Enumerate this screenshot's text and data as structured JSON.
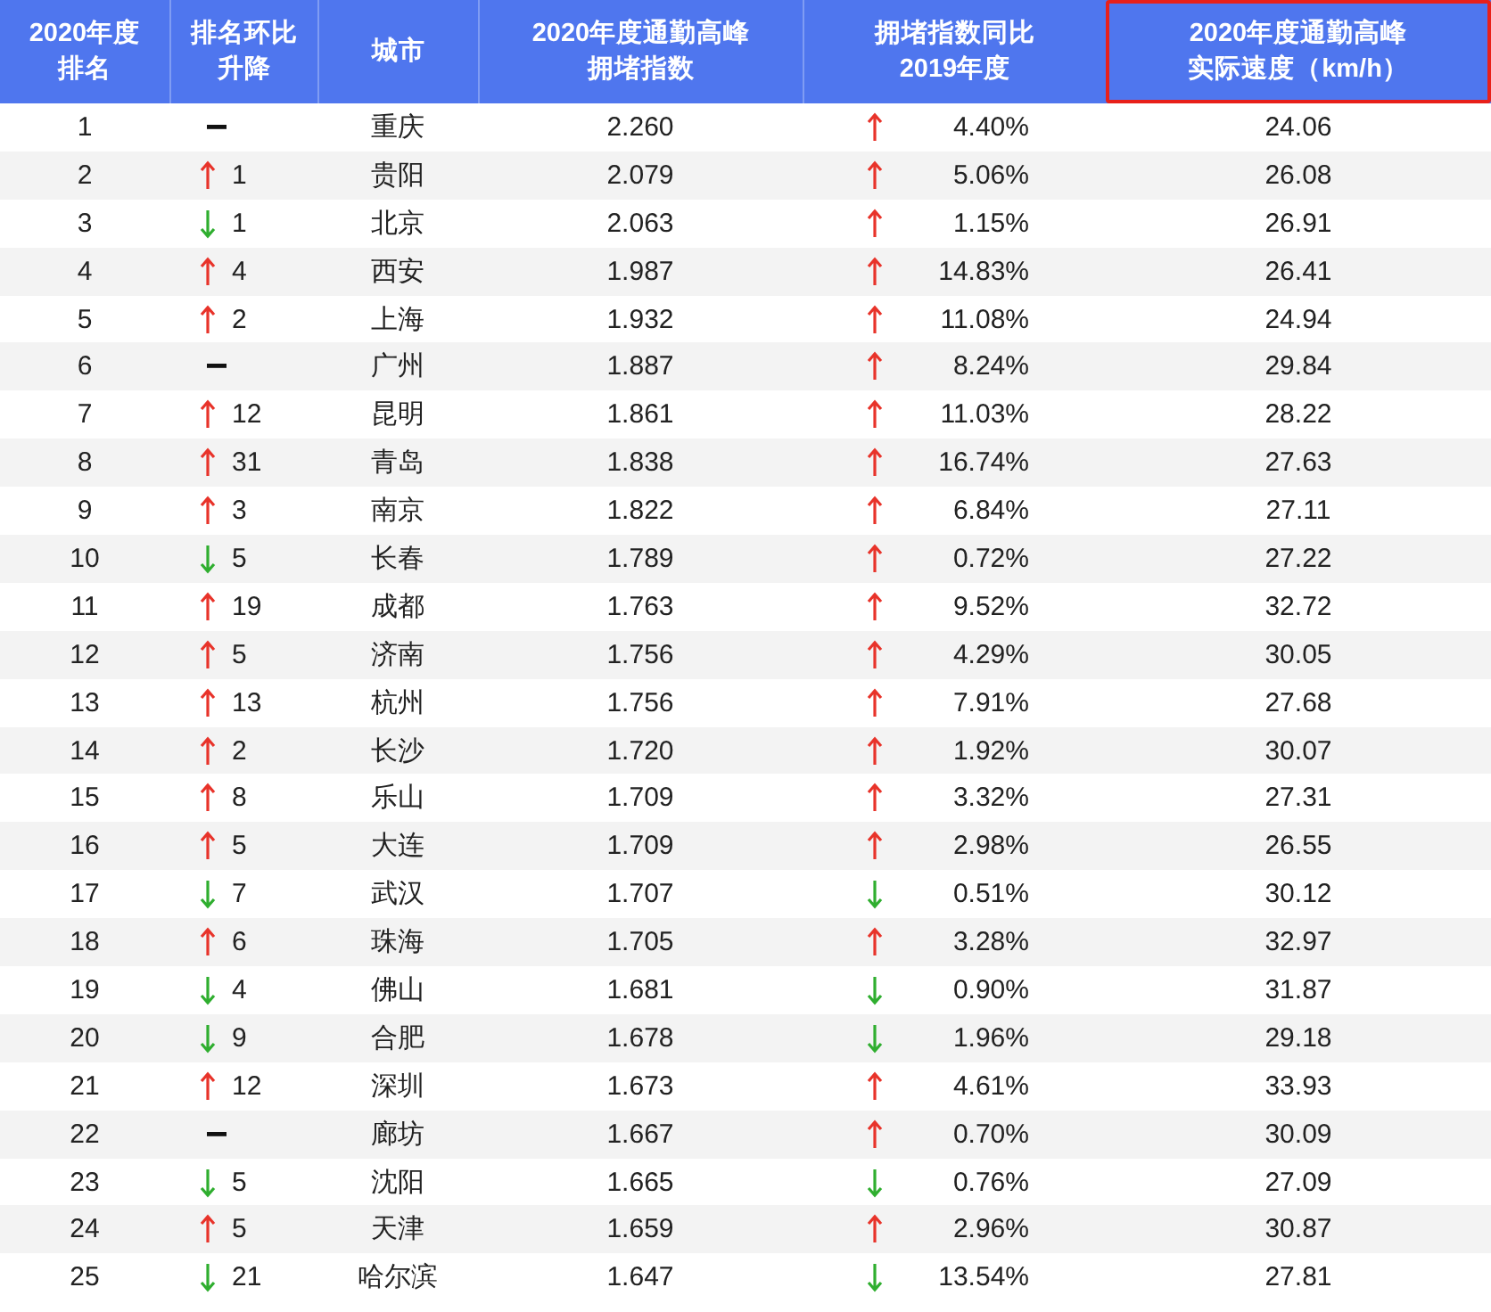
{
  "table": {
    "columns": [
      {
        "lines": [
          "2020年度",
          "排名"
        ],
        "highlighted": false
      },
      {
        "lines": [
          "排名环比",
          "升降"
        ],
        "highlighted": false
      },
      {
        "lines": [
          "城市"
        ],
        "highlighted": false
      },
      {
        "lines": [
          "2020年度通勤高峰",
          "拥堵指数"
        ],
        "highlighted": false
      },
      {
        "lines": [
          "拥堵指数同比",
          "2019年度"
        ],
        "highlighted": false
      },
      {
        "lines": [
          "2020年度通勤高峰",
          "实际速度（km/h）"
        ],
        "highlighted": true
      }
    ],
    "rows": [
      {
        "rank": "1",
        "rank_up": false,
        "rank_down": false,
        "city": "重庆",
        "index": "2.260",
        "yoy_up": true,
        "yoy_value": "4.40%",
        "speed": "24.06"
      },
      {
        "rank": "2",
        "rank_up": true,
        "rank_down": false,
        "rank_delta": "1",
        "city": "贵阳",
        "index": "2.079",
        "yoy_up": true,
        "yoy_value": "5.06%",
        "speed": "26.08"
      },
      {
        "rank": "3",
        "rank_up": false,
        "rank_down": true,
        "rank_delta": "1",
        "city": "北京",
        "index": "2.063",
        "yoy_up": true,
        "yoy_value": "1.15%",
        "speed": "26.91"
      },
      {
        "rank": "4",
        "rank_up": true,
        "rank_down": false,
        "rank_delta": "4",
        "city": "西安",
        "index": "1.987",
        "yoy_up": true,
        "yoy_value": "14.83%",
        "speed": "26.41"
      },
      {
        "rank": "5",
        "rank_up": true,
        "rank_down": false,
        "rank_delta": "2",
        "city": "上海",
        "index": "1.932",
        "yoy_up": true,
        "yoy_value": "11.08%",
        "speed": "24.94"
      },
      {
        "rank": "6",
        "rank_up": false,
        "rank_down": false,
        "city": "广州",
        "index": "1.887",
        "yoy_up": true,
        "yoy_value": "8.24%",
        "speed": "29.84"
      },
      {
        "rank": "7",
        "rank_up": true,
        "rank_down": false,
        "rank_delta": "12",
        "city": "昆明",
        "index": "1.861",
        "yoy_up": true,
        "yoy_value": "11.03%",
        "speed": "28.22"
      },
      {
        "rank": "8",
        "rank_up": true,
        "rank_down": false,
        "rank_delta": "31",
        "city": "青岛",
        "index": "1.838",
        "yoy_up": true,
        "yoy_value": "16.74%",
        "speed": "27.63"
      },
      {
        "rank": "9",
        "rank_up": true,
        "rank_down": false,
        "rank_delta": "3",
        "city": "南京",
        "index": "1.822",
        "yoy_up": true,
        "yoy_value": "6.84%",
        "speed": "27.11"
      },
      {
        "rank": "10",
        "rank_up": false,
        "rank_down": true,
        "rank_delta": "5",
        "city": "长春",
        "index": "1.789",
        "yoy_up": true,
        "yoy_value": "0.72%",
        "speed": "27.22"
      },
      {
        "rank": "11",
        "rank_up": true,
        "rank_down": false,
        "rank_delta": "19",
        "city": "成都",
        "index": "1.763",
        "yoy_up": true,
        "yoy_value": "9.52%",
        "speed": "32.72"
      },
      {
        "rank": "12",
        "rank_up": true,
        "rank_down": false,
        "rank_delta": "5",
        "city": "济南",
        "index": "1.756",
        "yoy_up": true,
        "yoy_value": "4.29%",
        "speed": "30.05"
      },
      {
        "rank": "13",
        "rank_up": true,
        "rank_down": false,
        "rank_delta": "13",
        "city": "杭州",
        "index": "1.756",
        "yoy_up": true,
        "yoy_value": "7.91%",
        "speed": "27.68"
      },
      {
        "rank": "14",
        "rank_up": true,
        "rank_down": false,
        "rank_delta": "2",
        "city": "长沙",
        "index": "1.720",
        "yoy_up": true,
        "yoy_value": "1.92%",
        "speed": "30.07"
      },
      {
        "rank": "15",
        "rank_up": true,
        "rank_down": false,
        "rank_delta": "8",
        "city": "乐山",
        "index": "1.709",
        "yoy_up": true,
        "yoy_value": "3.32%",
        "speed": "27.31"
      },
      {
        "rank": "16",
        "rank_up": true,
        "rank_down": false,
        "rank_delta": "5",
        "city": "大连",
        "index": "1.709",
        "yoy_up": true,
        "yoy_value": "2.98%",
        "speed": "26.55"
      },
      {
        "rank": "17",
        "rank_up": false,
        "rank_down": true,
        "rank_delta": "7",
        "city": "武汉",
        "index": "1.707",
        "yoy_up": false,
        "yoy_value": "0.51%",
        "speed": "30.12"
      },
      {
        "rank": "18",
        "rank_up": true,
        "rank_down": false,
        "rank_delta": "6",
        "city": "珠海",
        "index": "1.705",
        "yoy_up": true,
        "yoy_value": "3.28%",
        "speed": "32.97"
      },
      {
        "rank": "19",
        "rank_up": false,
        "rank_down": true,
        "rank_delta": "4",
        "city": "佛山",
        "index": "1.681",
        "yoy_up": false,
        "yoy_value": "0.90%",
        "speed": "31.87"
      },
      {
        "rank": "20",
        "rank_up": false,
        "rank_down": true,
        "rank_delta": "9",
        "city": "合肥",
        "index": "1.678",
        "yoy_up": false,
        "yoy_value": "1.96%",
        "speed": "29.18"
      },
      {
        "rank": "21",
        "rank_up": true,
        "rank_down": false,
        "rank_delta": "12",
        "city": "深圳",
        "index": "1.673",
        "yoy_up": true,
        "yoy_value": "4.61%",
        "speed": "33.93"
      },
      {
        "rank": "22",
        "rank_up": false,
        "rank_down": false,
        "city": "廊坊",
        "index": "1.667",
        "yoy_up": true,
        "yoy_value": "0.70%",
        "speed": "30.09"
      },
      {
        "rank": "23",
        "rank_up": false,
        "rank_down": true,
        "rank_delta": "5",
        "city": "沈阳",
        "index": "1.665",
        "yoy_up": false,
        "yoy_value": "0.76%",
        "speed": "27.09"
      },
      {
        "rank": "24",
        "rank_up": true,
        "rank_down": false,
        "rank_delta": "5",
        "city": "天津",
        "index": "1.659",
        "yoy_up": true,
        "yoy_value": "2.96%",
        "speed": "30.87"
      },
      {
        "rank": "25",
        "rank_up": false,
        "rank_down": true,
        "rank_delta": "21",
        "city": "哈尔滨",
        "index": "1.647",
        "yoy_up": false,
        "yoy_value": "13.54%",
        "speed": "27.81"
      }
    ]
  }
}
